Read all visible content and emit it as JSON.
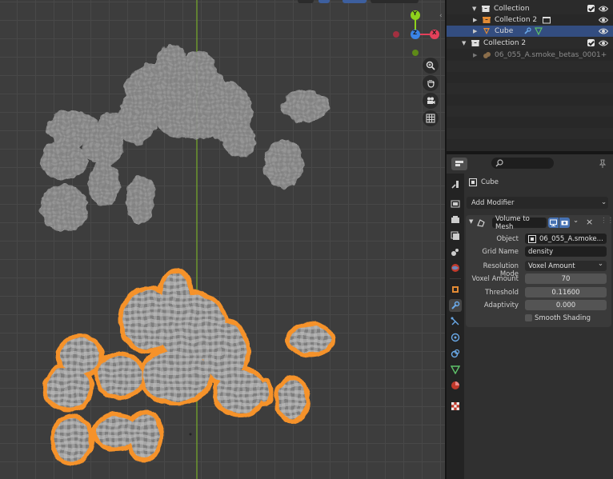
{
  "outliner": {
    "rows": [
      {
        "label": "Collection"
      },
      {
        "label": "Collection 2"
      },
      {
        "label": "Cube"
      },
      {
        "label": "Collection 2"
      },
      {
        "label": "06_055_A.smoke_betas_0001+"
      }
    ]
  },
  "properties": {
    "object_name": "Cube",
    "add_modifier_label": "Add Modifier",
    "modifier": {
      "name": "Volume to Mesh",
      "fields": [
        {
          "label": "Object",
          "value": "06_055_A.smoke..."
        },
        {
          "label": "Grid Name",
          "value": "density"
        },
        {
          "label": "Resolution Mode",
          "value": "Voxel Amount"
        },
        {
          "label": "Voxel Amount",
          "value": "70"
        },
        {
          "label": "Threshold",
          "value": "0.11600"
        },
        {
          "label": "Adaptivity",
          "value": "0.000"
        }
      ],
      "smooth_shading_label": "Smooth Shading"
    }
  },
  "viewport": {
    "gizmo": {
      "y_label": "Y",
      "z_label": "Z",
      "x_label": "X"
    }
  },
  "colors": {
    "accent_selection": "#334d80",
    "outline_orange": "#f5922a",
    "axis_x": "#e4405a",
    "axis_y": "#8fd21c",
    "axis_z": "#3a83e6"
  }
}
